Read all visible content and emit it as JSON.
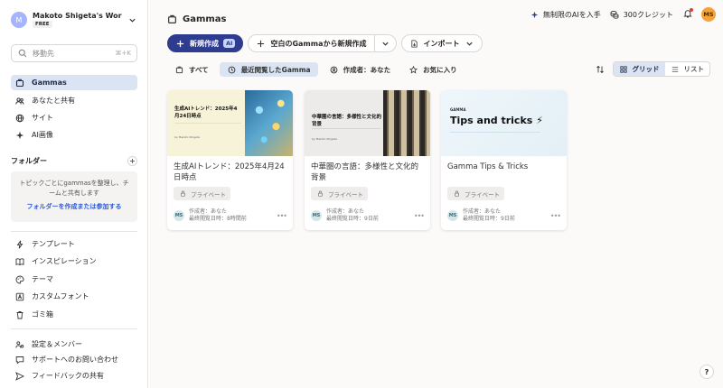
{
  "sidebar": {
    "workspace": {
      "initial": "M",
      "name": "Makoto Shigeta's Work...",
      "plan": "FREE"
    },
    "search": {
      "placeholder": "移動先",
      "shortcut": "⌘+K"
    },
    "nav": [
      {
        "label": "Gammas",
        "icon": "gamma-icon",
        "active": true
      },
      {
        "label": "あなたと共有",
        "icon": "users-icon",
        "active": false
      },
      {
        "label": "サイト",
        "icon": "globe-icon",
        "active": false
      },
      {
        "label": "AI画像",
        "icon": "sparkle-icon",
        "active": false
      }
    ],
    "folders": {
      "title": "フォルダー",
      "empty_text": "トピックごとにgammasを整理し、チームと共有します",
      "link": "フォルダーを作成または参加する"
    },
    "tools": [
      {
        "label": "テンプレート",
        "icon": "bolt-icon"
      },
      {
        "label": "インスピレーション",
        "icon": "book-icon"
      },
      {
        "label": "テーマ",
        "icon": "palette-icon"
      },
      {
        "label": "カスタムフォント",
        "icon": "font-icon"
      },
      {
        "label": "ゴミ箱",
        "icon": "trash-icon"
      }
    ],
    "bottom": [
      {
        "label": "設定＆メンバー",
        "icon": "settings-icon"
      },
      {
        "label": "サポートへのお問い合わせ",
        "icon": "chat-icon"
      },
      {
        "label": "フィードバックの共有",
        "icon": "send-icon"
      }
    ]
  },
  "header": {
    "title": "Gammas",
    "upgrade": "無制限のAIを入手",
    "credits": "300クレジット",
    "user_initials": "MS"
  },
  "actions": {
    "new_ai": "新規作成",
    "ai_badge": "AI",
    "blank": "空白のGammaから新規作成",
    "import": "インポート"
  },
  "filters": [
    {
      "label": "すべて",
      "icon": "stack-icon",
      "active": false
    },
    {
      "label": "最近閲覧したGamma",
      "icon": "clock-icon",
      "active": true
    },
    {
      "label": "作成者：あなた",
      "icon": "user-icon",
      "active": false
    },
    {
      "label": "お気に入り",
      "icon": "star-icon",
      "active": false
    }
  ],
  "view": {
    "grid": "グリッド",
    "list": "リスト"
  },
  "cards": [
    {
      "title": "生成AIトレンド：2025年4月24日時点",
      "thumb_title": "生成AIトレンド：2025年4月24日時点",
      "thumb_author": "by Makoto Shigeta",
      "privacy": "プライベート",
      "author_initials": "MS",
      "author": "作成者：あなた",
      "viewed": "最終閲覧日時：8時間前"
    },
    {
      "title": "中華圏の言語：多様性と文化的背景",
      "thumb_title": "中華圏の言語：多様性と文化的背景",
      "thumb_author": "by Makoto Shigeta",
      "privacy": "プライベート",
      "author_initials": "MS",
      "author": "作成者：あなた",
      "viewed": "最終閲覧日時：9日前"
    },
    {
      "title": "Gamma Tips & Tricks",
      "thumb_title": "Tips and tricks ⚡",
      "thumb_brand": "GAMMA",
      "privacy": "プライベート",
      "author_initials": "MS",
      "author": "作成者：あなた",
      "viewed": "最終閲覧日時：9日前"
    }
  ],
  "help": "?"
}
